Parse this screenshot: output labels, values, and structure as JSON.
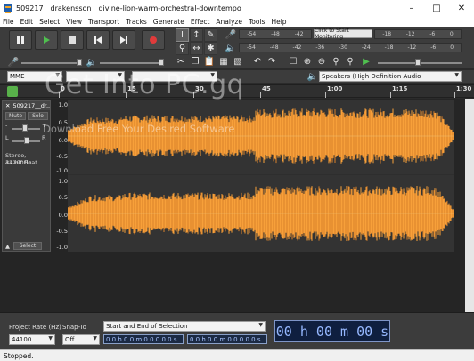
{
  "window": {
    "title": "509217__drakensson__divine-lion-warm-orchestral-downtempo"
  },
  "menu": [
    "File",
    "Edit",
    "Select",
    "View",
    "Transport",
    "Tracks",
    "Generate",
    "Effect",
    "Analyze",
    "Tools",
    "Help"
  ],
  "meters": {
    "record_ticks": [
      "-54",
      "-48",
      "-42",
      "Click to Start Monitoring",
      "-18",
      "-12",
      "-6",
      "0"
    ],
    "play_ticks": [
      "-54",
      "-48",
      "-42",
      "-36",
      "-30",
      "-24",
      "-18",
      "-12",
      "-6",
      "0"
    ],
    "monitor_label": "Click to Start Monitoring"
  },
  "device": {
    "host": "MME",
    "output": "Speakers (High Definition Audio"
  },
  "watermark": {
    "line1": "Get Into PC.gq",
    "line2": "Download Free Your Desired Software"
  },
  "ruler": {
    "ticks": [
      "0",
      "15",
      "30",
      "45",
      "1:00",
      "1:15",
      "1:30"
    ]
  },
  "track": {
    "name": "509217__dr...",
    "mute": "Mute",
    "solo": "Solo",
    "gain_minus": "-",
    "gain_plus": "+",
    "pan_l": "L",
    "pan_r": "R",
    "info1": "Stereo, 44100Hz",
    "info2": "32-bit float",
    "select": "Select",
    "scale_top": [
      "1.0",
      "0.5",
      "0.0",
      "-0.5",
      "-1.0"
    ],
    "scale_bottom": [
      "1.0",
      "0.5",
      "0.0",
      "-0.5",
      "-1.0"
    ],
    "colors": {
      "wave": "#f7a03a",
      "wave_dark": "#d9822b"
    }
  },
  "selection_toolbar": {
    "project_rate_label": "Project Rate (Hz)",
    "project_rate_value": "44100",
    "snap_label": "Snap-To",
    "snap_value": "Off",
    "selection_mode": "Start and End of Selection",
    "start_time": "0 0 h 0 0 m 0 0.0 0 0 s",
    "end_time": "0 0 h 0 0 m 0 0.0 0 0 s",
    "audio_position": "00 h 00 m 00 s"
  },
  "status": {
    "text": "Stopped."
  }
}
